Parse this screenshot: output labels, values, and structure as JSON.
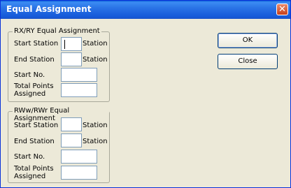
{
  "window": {
    "title": "Equal Assignment",
    "close_glyph": "✕"
  },
  "group1": {
    "title": "RX/RY Equal Assignment",
    "start_station_label": "Start Station",
    "end_station_label": "End Station",
    "start_station_unit": "Station",
    "end_station_unit": "Station",
    "start_no_label": "Start No.",
    "total_points_label_1": "Total Points",
    "total_points_label_2": "Assigned"
  },
  "group2": {
    "title": "RWw/RWr Equal Assignment",
    "start_station_label": "Start Station",
    "end_station_label": "End Station",
    "start_station_unit": "Station",
    "end_station_unit": "Station",
    "start_no_label": "Start No.",
    "total_points_label_1": "Total Points",
    "total_points_label_2": "Assigned"
  },
  "buttons": {
    "ok": "OK",
    "close": "Close"
  }
}
